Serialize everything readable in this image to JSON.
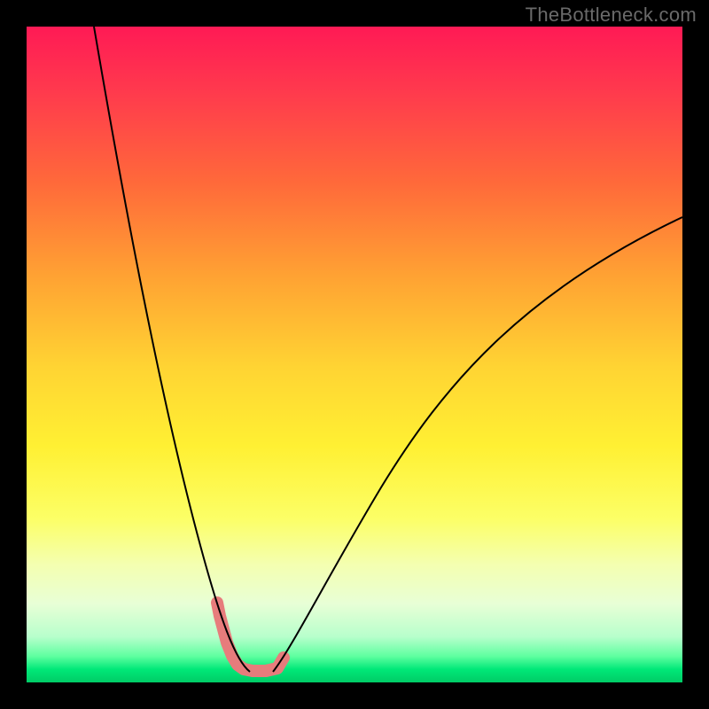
{
  "watermark": "TheBottleneck.com",
  "colors": {
    "page_bg": "#000000",
    "highlight": "#e77c7c",
    "curve": "#000000",
    "gradient_top": "#ff1a55",
    "gradient_mid": "#fff033",
    "gradient_bottom": "#00cc66"
  },
  "chart_data": {
    "type": "line",
    "title": "",
    "xlabel": "",
    "ylabel": "",
    "xlim": [
      0,
      100
    ],
    "ylim": [
      0,
      100
    ],
    "series": [
      {
        "name": "left-branch",
        "x": [
          10,
          12,
          14,
          16,
          18,
          20,
          22,
          24,
          26,
          28,
          30,
          32,
          33
        ],
        "values": [
          100,
          84,
          69,
          56,
          44,
          34,
          25,
          18,
          12,
          8,
          5,
          2,
          1
        ]
      },
      {
        "name": "right-branch",
        "x": [
          38,
          40,
          44,
          48,
          52,
          56,
          60,
          64,
          68,
          72,
          76,
          80,
          84,
          88,
          92,
          96,
          100
        ],
        "values": [
          1,
          2,
          5,
          9,
          14,
          19,
          24,
          29,
          34,
          39,
          44,
          49,
          54,
          58,
          63,
          67,
          71
        ]
      }
    ],
    "highlighted_region": {
      "description": "near-minimum segment",
      "x": [
        29,
        30,
        31,
        32,
        33,
        34,
        35,
        36,
        37,
        38,
        39
      ],
      "values": [
        12,
        9,
        6,
        3,
        1,
        1,
        1,
        1,
        1,
        2,
        3
      ]
    },
    "annotations": []
  }
}
